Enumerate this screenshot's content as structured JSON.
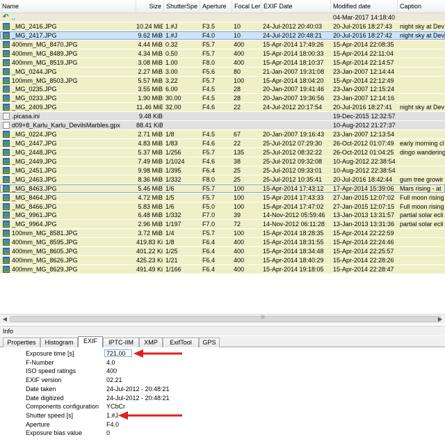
{
  "columns": {
    "name": "Name",
    "size": "Size",
    "shutter": "ShutterSpe",
    "aperture": "Aperture",
    "focal": "Focal Ler",
    "exif_date": "EXIF Date",
    "modified": "Modified date",
    "caption": "Caption"
  },
  "files": [
    {
      "icon": "up",
      "name": "..",
      "size": "",
      "shutter": "",
      "aperture": "",
      "focal": "",
      "exif_date": "",
      "modified": "04-Mar-2017 14:18:40",
      "caption": "",
      "bg": "#ece9d8"
    },
    {
      "icon": "img",
      "name": "_MG_2416.JPG",
      "size": "10.24 MiB",
      "shutter": "1.#J",
      "aperture": "F3.5",
      "focal": "10",
      "exif_date": "24-Jul-2012 20:40:03",
      "modified": "20-Jul-2016 18:27:43",
      "caption": "night sky at Dev",
      "bg": "#f0f0c8"
    },
    {
      "icon": "img",
      "name": "_MG_2417.JPG",
      "size": "9.62 MiB",
      "shutter": "1.#J",
      "aperture": "F4.0",
      "focal": "10",
      "exif_date": "24-Jul-2012 20:48:21",
      "modified": "20-Jul-2016 18:27:42",
      "caption": "night sky at Dev",
      "bg": "#f0f0c8",
      "selected": true
    },
    {
      "icon": "img",
      "name": "400mm_MG_8470.JPG",
      "size": "4.44 MiB",
      "shutter": "0.32",
      "aperture": "F5.7",
      "focal": "400",
      "exif_date": "15-Apr-2014 17:49:26",
      "modified": "15-Apr-2014 22:08:35",
      "caption": "",
      "bg": "#f0f0c8"
    },
    {
      "icon": "img",
      "name": "400mm_MG_8489.JPG",
      "size": "4.34 MiB",
      "shutter": "0.50",
      "aperture": "F5.7",
      "focal": "400",
      "exif_date": "15-Apr-2014 18:00:33",
      "modified": "15-Apr-2014 22:11:04",
      "caption": "",
      "bg": "#f0f0c8"
    },
    {
      "icon": "img",
      "name": "400mm_MG_8519.JPG",
      "size": "3.08 MiB",
      "shutter": "1.00",
      "aperture": "F8.0",
      "focal": "400",
      "exif_date": "15-Apr-2014 18:10:37",
      "modified": "15-Apr-2014 22:14:57",
      "caption": "",
      "bg": "#f0f0c8"
    },
    {
      "icon": "img",
      "name": "_MG_0244.JPG",
      "size": "2.27 MiB",
      "shutter": "3.00",
      "aperture": "F5.6",
      "focal": "80",
      "exif_date": "21-Jan-2007 19:31:08",
      "modified": "23-Jan-2007 12:14:44",
      "caption": "",
      "bg": "#f0f0c8"
    },
    {
      "icon": "img",
      "name": "100mm_MG_8503.JPG",
      "size": "5.57 MiB",
      "shutter": "3.22",
      "aperture": "F5.7",
      "focal": "100",
      "exif_date": "15-Apr-2014 18:04:20",
      "modified": "15-Apr-2014 22:12:49",
      "caption": "",
      "bg": "#f0f0c8"
    },
    {
      "icon": "img",
      "name": "_MG_0235.JPG",
      "size": "3.55 MiB",
      "shutter": "6.00",
      "aperture": "F4.5",
      "focal": "28",
      "exif_date": "20-Jan-2007 19:41:46",
      "modified": "23-Jan-2007 12:15:24",
      "caption": "",
      "bg": "#f0f0c8"
    },
    {
      "icon": "img",
      "name": "_MG_0233.JPG",
      "size": "1.90 MiB",
      "shutter": "30.00",
      "aperture": "F4.5",
      "focal": "28",
      "exif_date": "20-Jan-2007 19:36:56",
      "modified": "23-Jan-2007 12:14:16",
      "caption": "",
      "bg": "#f0f0c8"
    },
    {
      "icon": "img",
      "name": "_MG_2409.JPG",
      "size": "11.46 MiB",
      "shutter": "32.00",
      "aperture": "F4.6",
      "focal": "22",
      "exif_date": "24-Jul-2012 20:17:54",
      "modified": "20-Jul-2016 18:27:41",
      "caption": "night sky at Dev",
      "bg": "#f0f0c8"
    },
    {
      "icon": "doc",
      "name": ".picasa.ini",
      "size": "9.48 KiB",
      "shutter": "",
      "aperture": "",
      "focal": "",
      "exif_date": "",
      "modified": "19-Dec-2015 12:32:57",
      "caption": "",
      "bg": "#e0e0e0"
    },
    {
      "icon": "gpx",
      "name": "d09+8_Karlu_Karlu_DevilsMarbles.gpx",
      "size": "88.41 KiB",
      "shutter": "",
      "aperture": "",
      "focal": "",
      "exif_date": "",
      "modified": "10-Aug-2012 21:27:37",
      "caption": "",
      "bg": "#e0e0e0"
    },
    {
      "icon": "img",
      "name": "_MG_0224.JPG",
      "size": "2.71 MiB",
      "shutter": "1/8",
      "aperture": "F4.5",
      "focal": "67",
      "exif_date": "20-Jan-2007 19:16:43",
      "modified": "23-Jan-2007 12:13:54",
      "caption": "",
      "bg": "#f0f0c8"
    },
    {
      "icon": "img",
      "name": "_MG_2447.JPG",
      "size": "4.83 MiB",
      "shutter": "1/83",
      "aperture": "F4.6",
      "focal": "22",
      "exif_date": "25-Jul-2012 07:29:30",
      "modified": "26-Oct-2012 01:07:49",
      "caption": "early morning cl",
      "bg": "#f0f0c8"
    },
    {
      "icon": "img",
      "name": "_MG_2448.JPG",
      "size": "5.37 MiB",
      "shutter": "1/256",
      "aperture": "F5.7",
      "focal": "135",
      "exif_date": "25-Jul-2012 08:32:22",
      "modified": "26-Oct-2012 01:04:25",
      "caption": "dingo wandering",
      "bg": "#f0f0c8"
    },
    {
      "icon": "img",
      "name": "_MG_2449.JPG",
      "size": "7.49 MiB",
      "shutter": "1/1024",
      "aperture": "F4.6",
      "focal": "38",
      "exif_date": "25-Jul-2012 09:32:08",
      "modified": "10-Aug-2012 22:38:54",
      "caption": "",
      "bg": "#f0f0c8"
    },
    {
      "icon": "img",
      "name": "_MG_2451.JPG",
      "size": "9.98 MiB",
      "shutter": "1/395",
      "aperture": "F6.4",
      "focal": "25",
      "exif_date": "25-Jul-2012 09:33:01",
      "modified": "10-Aug-2012 22:38:54",
      "caption": "",
      "bg": "#f0f0c8"
    },
    {
      "icon": "img",
      "name": "_MG_2463.JPG",
      "size": "8.36 MiB",
      "shutter": "1/332",
      "aperture": "F8.0",
      "focal": "25",
      "exif_date": "25-Jul-2012 10:35:41",
      "modified": "20-Jul-2016 18:42:44",
      "caption": "gum tree growir",
      "bg": "#f0f0c8"
    },
    {
      "icon": "img",
      "name": "_MG_8463.JPG",
      "size": "5.46 MiB",
      "shutter": "1/6",
      "aperture": "F5.7",
      "focal": "100",
      "exif_date": "15-Apr-2014 17:43:12",
      "modified": "17-Apr-2014 15:39:06",
      "caption": "Mars rising - at",
      "bg": "#f0f0c8",
      "outlined": true
    },
    {
      "icon": "img",
      "name": "_MG_8464.JPG",
      "size": "4.72 MiB",
      "shutter": "1/5",
      "aperture": "F5.7",
      "focal": "100",
      "exif_date": "15-Apr-2014 17:43:33",
      "modified": "27-Jan-2015 12:07:02",
      "caption": "Full moon rising",
      "bg": "#f0f0c8"
    },
    {
      "icon": "img",
      "name": "_MG_8466.JPG",
      "size": "5.83 MiB",
      "shutter": "1/6",
      "aperture": "F5.0",
      "focal": "100",
      "exif_date": "15-Apr-2014 17:47:02",
      "modified": "27-Jan-2015 12:07:15",
      "caption": "Full moon rising",
      "bg": "#f0f0c8"
    },
    {
      "icon": "img",
      "name": "_MG_9961.JPG",
      "size": "6.48 MiB",
      "shutter": "1/332",
      "aperture": "F7.0",
      "focal": "39",
      "exif_date": "14-Nov-2012 05:59:46",
      "modified": "13-Jan-2013 13:31:57",
      "caption": "partial solar ecli",
      "bg": "#f0f0c8"
    },
    {
      "icon": "img",
      "name": "_MG_9964.JPG",
      "size": "2.96 MiB",
      "shutter": "1/197",
      "aperture": "F7.0",
      "focal": "72",
      "exif_date": "14-Nov-2012 06:11:28",
      "modified": "13-Jan-2013 13:31:36",
      "caption": "partial solar ecli",
      "bg": "#f0f0c8"
    },
    {
      "icon": "img",
      "name": "100mm_MG_8581.JPG",
      "size": "3.72 MiB",
      "shutter": "1/4",
      "aperture": "F5.7",
      "focal": "100",
      "exif_date": "15-Apr-2014 18:28:35",
      "modified": "15-Apr-2014 22:22:59",
      "caption": "",
      "bg": "#f0f0c8"
    },
    {
      "icon": "img",
      "name": "400mm_MG_8595.JPG",
      "size": "419.83 KiB",
      "shutter": "1/8",
      "aperture": "F6.4",
      "focal": "400",
      "exif_date": "15-Apr-2014 18:31:55",
      "modified": "15-Apr-2014 22:24:46",
      "caption": "",
      "bg": "#f0f0c8"
    },
    {
      "icon": "img",
      "name": "400mm_MG_8605.JPG",
      "size": "401.22 KiB",
      "shutter": "1/25",
      "aperture": "F6.4",
      "focal": "400",
      "exif_date": "15-Apr-2014 18:34:48",
      "modified": "15-Apr-2014 22:25:57",
      "caption": "",
      "bg": "#f0f0c8"
    },
    {
      "icon": "img",
      "name": "400mm_MG_8626.JPG",
      "size": "425.23 KiB",
      "shutter": "1/21",
      "aperture": "F6.4",
      "focal": "400",
      "exif_date": "15-Apr-2014 18:40:29",
      "modified": "15-Apr-2014 22:28:26",
      "caption": "",
      "bg": "#f0f0c8"
    },
    {
      "icon": "img",
      "name": "400mm_MG_8629.JPG",
      "size": "491.49 KiB",
      "shutter": "1/166",
      "aperture": "F6.4",
      "focal": "400",
      "exif_date": "15-Apr-2014 19:18:05",
      "modified": "15-Apr-2014 22:28:47",
      "caption": "",
      "bg": "#f0f0c8"
    }
  ],
  "scrollbar": {
    "left_arrow": "◀",
    "grip": "III",
    "right_arrow": "▶"
  },
  "info": {
    "title": "Info",
    "tabs": [
      {
        "label": "Properties",
        "active": false
      },
      {
        "label": "Histogram",
        "active": false
      },
      {
        "label": "EXIF",
        "active": true
      },
      {
        "label": "IPTC-IIM",
        "active": false
      },
      {
        "label": "XMP",
        "active": false
      },
      {
        "label": "ExifTool",
        "active": false
      },
      {
        "label": "GPS",
        "active": false
      }
    ],
    "properties": [
      {
        "name": "Exposure time [s]",
        "value": "721.00",
        "boxed": true,
        "arrow": true
      },
      {
        "name": "F-Number",
        "value": "4.0"
      },
      {
        "name": "ISO speed ratings",
        "value": "400"
      },
      {
        "name": "EXIF version",
        "value": "02.21"
      },
      {
        "name": "Date taken",
        "value": "24-Jul-2012 - 20:48:21"
      },
      {
        "name": "Date digitized",
        "value": "24-Jul-2012 - 20:48:21"
      },
      {
        "name": "Components configuration",
        "value": "YCbCr"
      },
      {
        "name": "Shutter speed [s]",
        "value": "1.#J",
        "arrow": true
      },
      {
        "name": "Aperture",
        "value": "F4.0"
      },
      {
        "name": "Exposure bias value",
        "value": "0"
      }
    ]
  },
  "colors": {
    "selected_row": "#cde3f7",
    "selected_border": "#7da2ce",
    "arrow": "#e02020"
  }
}
